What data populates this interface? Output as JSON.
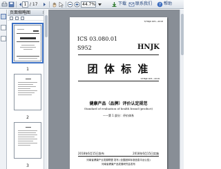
{
  "toolbar": {
    "current_page": "1",
    "page_total": "/ 17",
    "zoom": "44.7%",
    "links": [
      "下载",
      "联系我们",
      "帮助"
    ]
  },
  "sidebar": {
    "panel_title": "页面缩略图",
    "close_glyph": "×",
    "thumbnails": [
      {
        "page_label": "1",
        "selected": true
      },
      {
        "page_label": "2",
        "selected": false
      },
      {
        "page_label": "3",
        "selected": false
      }
    ]
  },
  "document": {
    "doc_id": "T/HNJK 005—2018",
    "ics": "ICS 03.080.01",
    "ccs": "S952",
    "brand": "HNJK",
    "standard_type": "团 体 标 准",
    "standard_no": "T/HNJK 005—2018",
    "title_cn": "健康产品（品牌）评价认定规范",
    "title_en": "Standard of evaluation of health brand (product)",
    "part": "——第 1 部分：评价体系",
    "publish_date": "2018年6月15日发布",
    "implement_date": "2018年6月15日实施",
    "issuer_line1": "河南省健康产业发展联盟 发布 (全国团体标准信息平台公告)",
    "issuer_line2": "河南省健康产品发展研究会发布"
  },
  "colors": {
    "toolbar_bg": "#dde3ea",
    "doc_background": "#888e96",
    "selection": "#3a6fc4"
  }
}
